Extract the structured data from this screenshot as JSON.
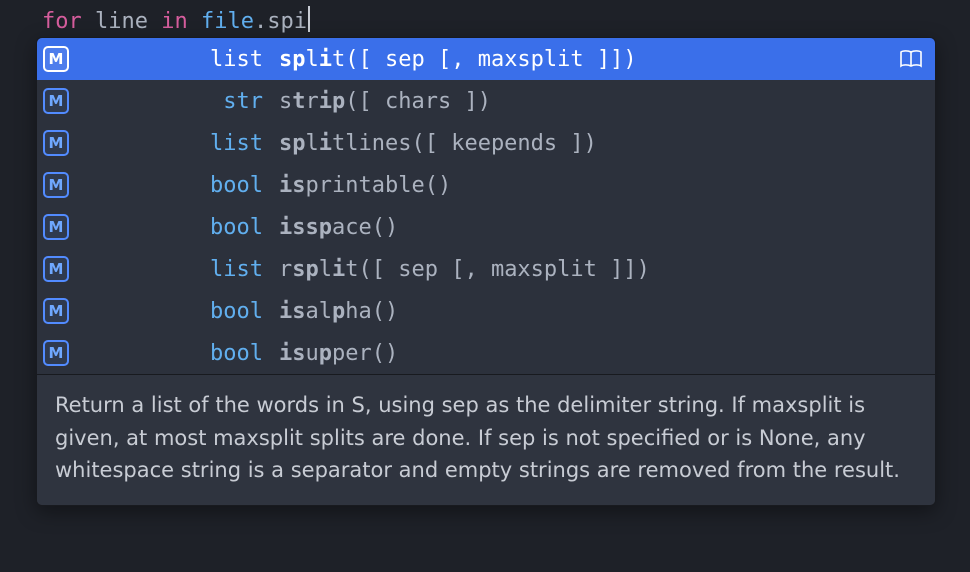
{
  "code": {
    "tokens": [
      {
        "cls": "kw",
        "text": "for"
      },
      {
        "cls": "",
        "text": " "
      },
      {
        "cls": "var",
        "text": "line"
      },
      {
        "cls": "",
        "text": " "
      },
      {
        "cls": "kw",
        "text": "in"
      },
      {
        "cls": "",
        "text": " "
      },
      {
        "cls": "obj",
        "text": "file"
      },
      {
        "cls": "dot",
        "text": "."
      },
      {
        "cls": "typed",
        "text": "spi"
      }
    ]
  },
  "completions": [
    {
      "selected": true,
      "return_type": "list",
      "segments": [
        "",
        "sp",
        "l",
        "i",
        "t",
        "([ sep [, maxsplit ]])"
      ],
      "bold": [
        false,
        true,
        false,
        true,
        false,
        false
      ],
      "show_doc_icon": true
    },
    {
      "selected": false,
      "return_type": "str",
      "segments": [
        "s",
        "t",
        "r",
        "ip",
        "([ chars ])"
      ],
      "bold": [
        false,
        true,
        false,
        true,
        false
      ]
    },
    {
      "selected": false,
      "return_type": "list",
      "segments": [
        "",
        "sp",
        "l",
        "i",
        "tlines([ keepends ])"
      ],
      "bold": [
        false,
        true,
        false,
        true,
        false
      ]
    },
    {
      "selected": false,
      "return_type": "bool",
      "segments": [
        "",
        "is",
        "p",
        "rintable()"
      ],
      "bold": [
        false,
        true,
        false,
        false
      ]
    },
    {
      "selected": false,
      "return_type": "bool",
      "segments": [
        "",
        "is",
        "",
        "sp",
        "ace()"
      ],
      "bold": [
        false,
        true,
        false,
        true,
        false
      ]
    },
    {
      "selected": false,
      "return_type": "list",
      "segments": [
        "r",
        "sp",
        "l",
        "i",
        "t([ sep [, maxsplit ]])"
      ],
      "bold": [
        false,
        true,
        false,
        true,
        false
      ]
    },
    {
      "selected": false,
      "return_type": "bool",
      "segments": [
        "",
        "is",
        "al",
        "p",
        "ha()"
      ],
      "bold": [
        false,
        true,
        false,
        true,
        false
      ]
    },
    {
      "selected": false,
      "return_type": "bool",
      "segments": [
        "",
        "is",
        "u",
        "p",
        "per()"
      ],
      "bold": [
        false,
        true,
        false,
        true,
        false
      ]
    }
  ],
  "icon_letter": "M",
  "documentation": "Return a list of the words in S, using sep as the delimiter string. If maxsplit is given, at most maxsplit splits are done. If sep is not specified or is None, any whitespace string is a separator and empty strings are removed from the result."
}
